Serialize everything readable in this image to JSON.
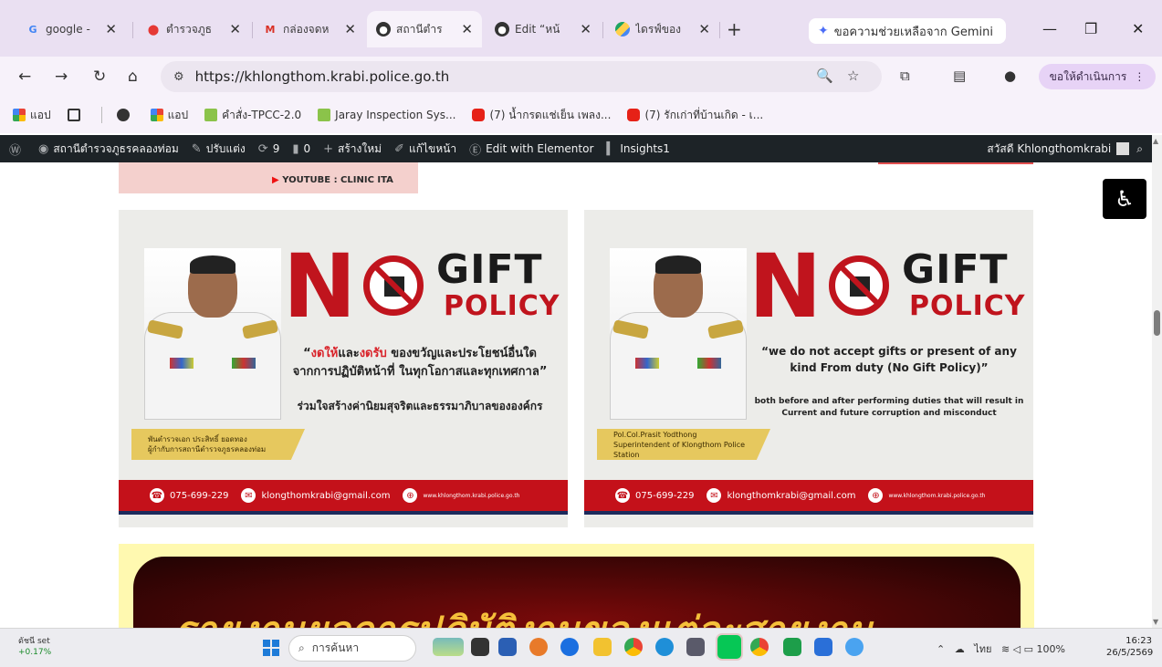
{
  "tabs": [
    {
      "label": "google -",
      "favicon": "google-icon",
      "active": false
    },
    {
      "label": "ตำรวจภูธ",
      "favicon": "map-pin-icon",
      "active": false
    },
    {
      "label": "กล่องจดห",
      "favicon": "gmail-icon",
      "active": false
    },
    {
      "label": "สถานีตำร",
      "favicon": "site-icon",
      "active": true
    },
    {
      "label": "Edit “หน้",
      "favicon": "site-icon",
      "active": false
    },
    {
      "label": "ไดรฟ์ของ",
      "favicon": "drive-icon",
      "active": false
    }
  ],
  "gemini_label": "ขอความช่วยเหลือจาก Gemini",
  "url": "https://khlongthom.krabi.police.go.th",
  "profile_button": "ขอให้ดำเนินการ",
  "bookmarks": [
    {
      "label": "แอป",
      "icon": "apps-grid-icon"
    },
    {
      "label": "",
      "icon": "grid-icon"
    },
    {
      "label": "",
      "icon": "chrome-icon"
    },
    {
      "label": "แอป",
      "icon": "apps-grid-icon"
    },
    {
      "label": "คำสั่ง-TPCC-2.0",
      "icon": "pen-icon"
    },
    {
      "label": "Jaray Inspection Sys...",
      "icon": "pen-icon"
    },
    {
      "label": "(7) น้ำกรดแช่เย็น เพลง...",
      "icon": "youtube-icon"
    },
    {
      "label": "(7) รักเก่าที่บ้านเกิด - เ...",
      "icon": "youtube-icon"
    }
  ],
  "wpbar": {
    "site_name": "สถานีตำรวจภูธรคลองท่อม",
    "customize": "ปรับแต่ง",
    "updates": "9",
    "comments": "0",
    "new": "สร้างใหม่",
    "edit_page": "แก้ไขหน้า",
    "elementor": "Edit with Elementor",
    "insights": "Insights1",
    "greeting": "สวัสดี Khlongthomkrabi"
  },
  "prev_banner_text": "YOUTUBE : CLINIC ITA",
  "card_th": {
    "n": "N",
    "gift": "GIFT",
    "policy": "POLICY",
    "line1_red1": "งดให้",
    "line1_mid": "และ",
    "line1_red2": "งดรับ",
    "line1_rest": " ของขวัญและประโยชน์อื่นใด",
    "line2": "จากการปฏิบัติหน้าที่ ในทุกโอกาสและทุกเทศกาล”",
    "line3": "ร่วมใจสร้างค่านิยมสุจริตและธรรมาภิบาลขององค์กร",
    "name1": "พันตำรวจเอก ประสิทธิ์ ยอดทอง",
    "name2": "ผู้กำกับการสถานีตำรวจภูธรคลองท่อม",
    "phone": "075-699-229",
    "email": "klongthomkrabi@gmail.com",
    "web": "www.khlongthom.krabi.police.go.th"
  },
  "card_en": {
    "n": "N",
    "gift": "GIFT",
    "policy": "POLICY",
    "line1": "“we do not accept gifts or present of any kind From duty (No Gift Policy)”",
    "line2": "both before and after performing duties that will result in Current and future corruption and misconduct",
    "name1": "Pol.Col.Prasit Yodthong",
    "name2": "Superintendent of Klongthom Police Station",
    "phone": "075-699-229",
    "email": "klongthomkrabi@gmail.com",
    "web": "www.khlongthom.krabi.police.go.th"
  },
  "report_banner": "รายงานผลการปฏิบัติงานของแต่ละสายงาน",
  "taskbar": {
    "weather_label": "ดัชนี set",
    "weather_change": "+0.17%",
    "search_placeholder": "การค้นหา",
    "tray_lang": "ไทย",
    "battery": "100%",
    "time": "16:23",
    "date": "26/5/2569"
  }
}
